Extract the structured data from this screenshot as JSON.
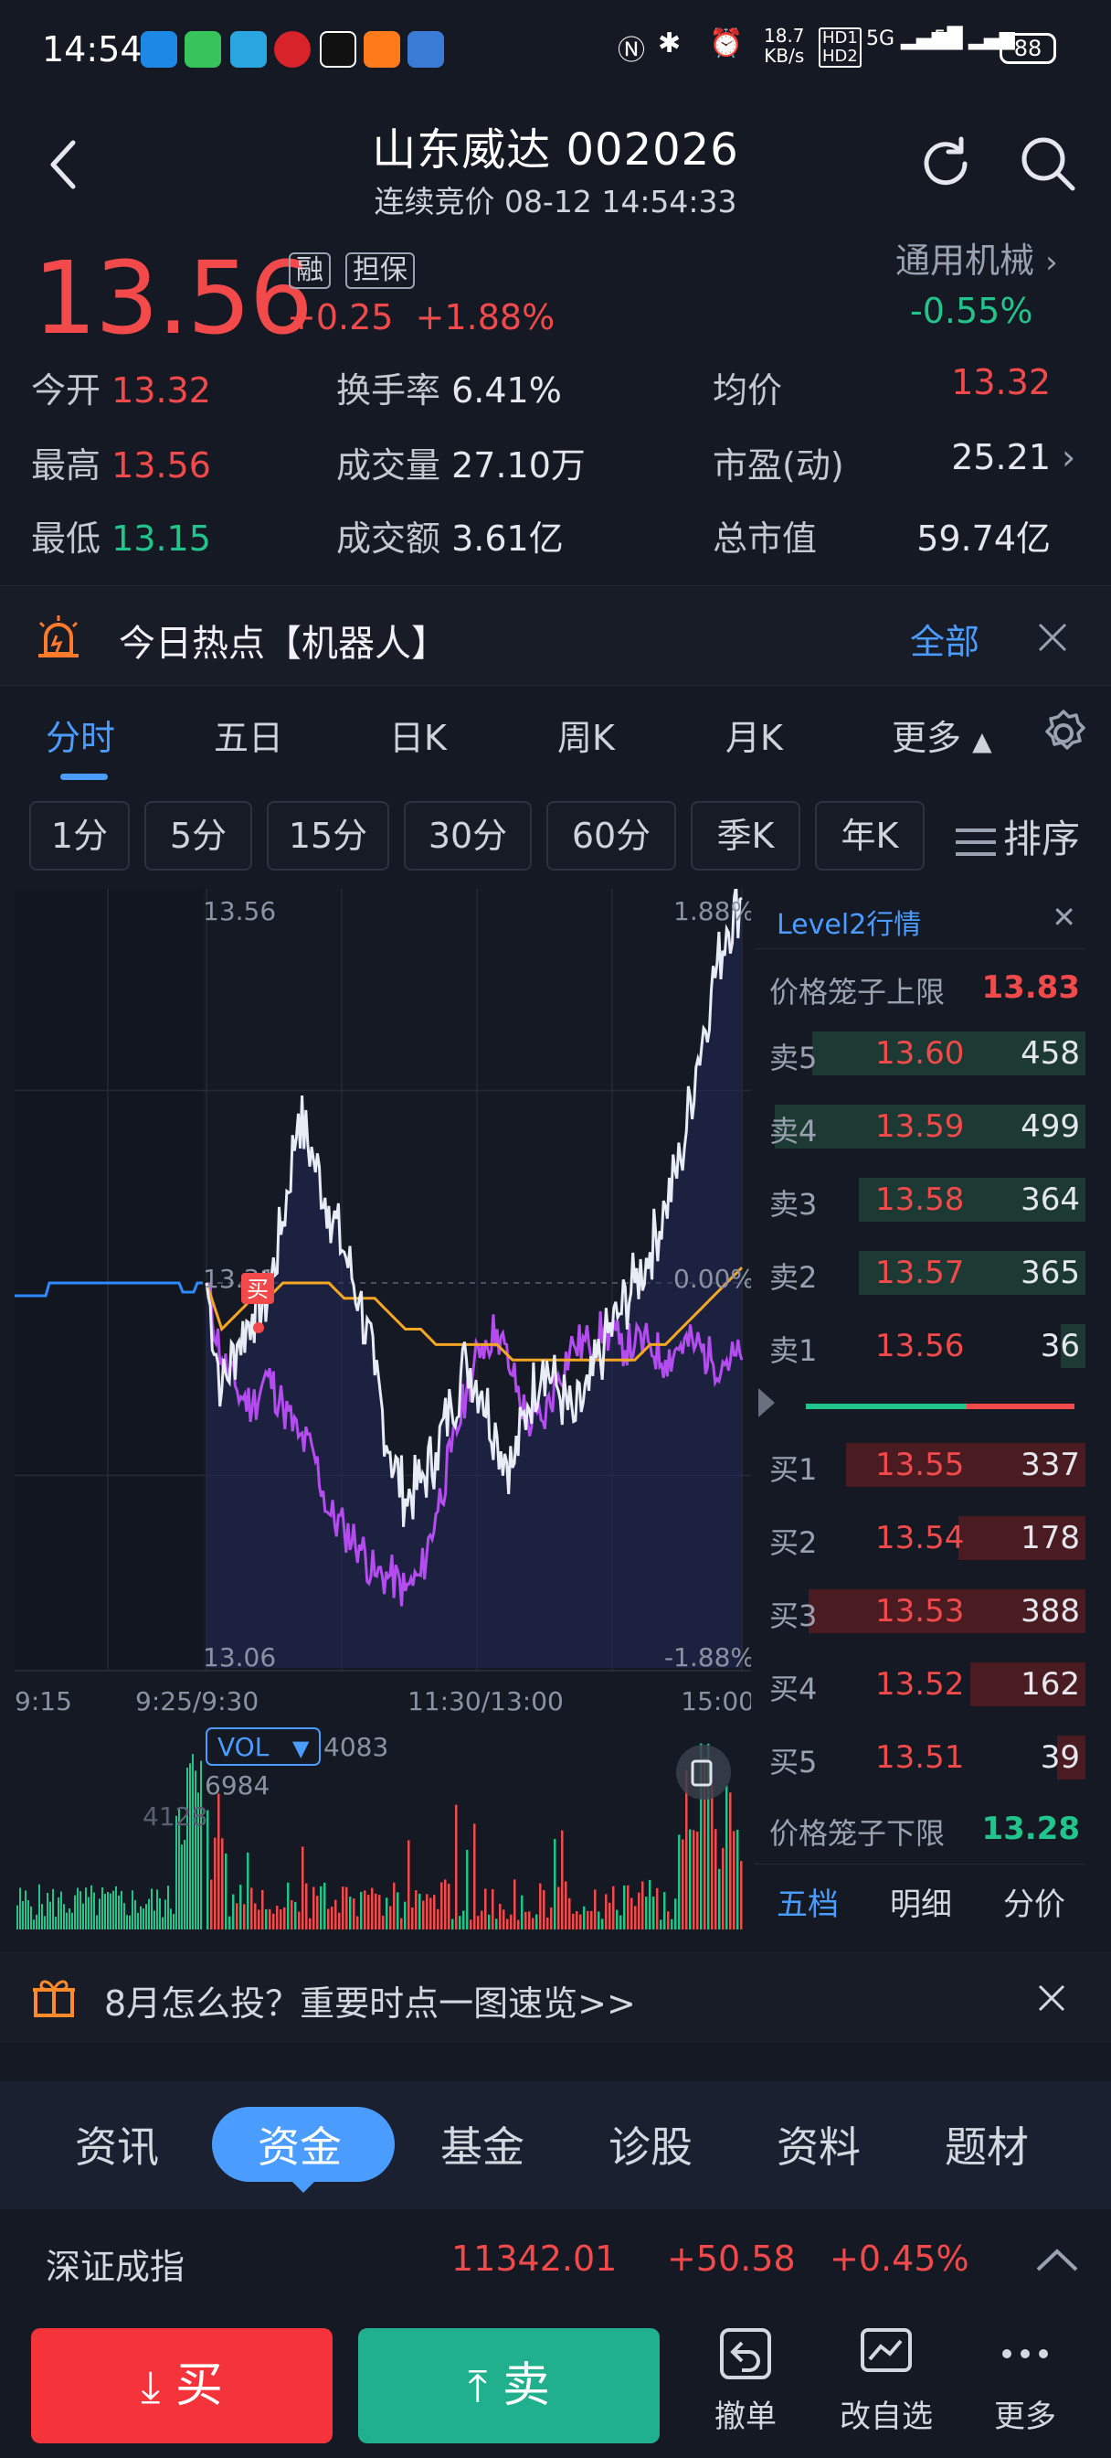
{
  "status_bar": {
    "time": "14:54",
    "network_speed_top": "18.7",
    "network_speed_unit": "KB/s",
    "hd1": "HD1",
    "hd2": "HD2",
    "sim1": "5G",
    "sim2": "5G",
    "battery": "88"
  },
  "header": {
    "title": "山东威达 002026",
    "subtitle": "连续竞价 08-12 14:54:33"
  },
  "quote": {
    "price": "13.56",
    "tag_margin": "融",
    "tag_guarantee": "担保",
    "change_abs": "+0.25",
    "change_pct": "+1.88%",
    "industry": "通用机械",
    "industry_change": "-0.55%"
  },
  "stats": [
    {
      "label": "今开",
      "value": "13.32"
    },
    {
      "label": "换手率",
      "value": "6.41%"
    },
    {
      "label": "均价",
      "value": "13.32"
    },
    {
      "label": "最高",
      "value": "13.56"
    },
    {
      "label": "成交量",
      "value": "27.10万"
    },
    {
      "label": "市盈(动)",
      "value": "25.21"
    },
    {
      "label": "最低",
      "value": "13.15"
    },
    {
      "label": "成交额",
      "value": "3.61亿"
    },
    {
      "label": "总市值",
      "value": "59.74亿"
    }
  ],
  "hot_topic": {
    "text": "今日热点【机器人】",
    "all_label": "全部"
  },
  "tabs": [
    "分时",
    "五日",
    "日K",
    "周K",
    "月K",
    "更多"
  ],
  "periods": [
    "1分",
    "5分",
    "15分",
    "30分",
    "60分",
    "季K",
    "年K"
  ],
  "sort_label": "排序",
  "chart": {
    "price_top": "13.56",
    "price_mid": "13.31",
    "price_bottom": "13.06",
    "pct_top": "1.88%",
    "pct_mid": "0.00%",
    "pct_bottom": "-1.88%",
    "time_labels": [
      "9:15",
      "9:25/9:30",
      "11:30/13:00",
      "15:00"
    ],
    "buy_marker": "买",
    "vol_label": "VOL",
    "vol_value": "4083",
    "vol_max": "6984",
    "vol_mid": "4128",
    "colors": {
      "price": "#e8ecf4",
      "avg": "#f5a623",
      "index": "#b44cf0",
      "vol_up": "#f24a4a",
      "vol_down": "#21c48a",
      "auction": "#2e8bff"
    }
  },
  "chart_data": {
    "type": "line",
    "ylim": [
      13.06,
      13.56
    ],
    "series": [
      {
        "values": [
          13.31,
          13.24,
          13.27,
          13.29,
          13.3,
          13.35,
          13.42,
          13.39,
          13.36,
          13.33,
          13.3,
          13.25,
          13.2,
          13.17,
          13.18,
          13.2,
          13.23,
          13.26,
          13.24,
          13.21,
          13.19,
          13.23,
          13.26,
          13.24,
          13.22,
          13.24,
          13.27,
          13.29,
          13.31,
          13.33,
          13.36,
          13.39,
          13.45,
          13.5,
          13.54,
          13.56
        ]
      },
      {
        "values": [
          13.31,
          13.28,
          13.29,
          13.3,
          13.3,
          13.31,
          13.31,
          13.31,
          13.31,
          13.3,
          13.3,
          13.3,
          13.29,
          13.28,
          13.28,
          13.27,
          13.27,
          13.27,
          13.27,
          13.27,
          13.26,
          13.26,
          13.26,
          13.26,
          13.26,
          13.26,
          13.26,
          13.26,
          13.26,
          13.27,
          13.27,
          13.28,
          13.29,
          13.3,
          13.31,
          13.32
        ]
      },
      {
        "values": [
          13.31,
          13.26,
          13.24,
          13.23,
          13.25,
          13.23,
          13.21,
          13.2,
          13.16,
          13.15,
          13.14,
          13.12,
          13.12,
          13.11,
          13.12,
          13.16,
          13.2,
          13.24,
          13.27,
          13.28,
          13.25,
          13.22,
          13.22,
          13.25,
          13.27,
          13.27,
          13.28,
          13.27,
          13.27,
          13.27,
          13.26,
          13.27,
          13.27,
          13.26,
          13.26,
          13.26
        ]
      }
    ]
  },
  "level2": {
    "title": "Level2行情",
    "upper_label": "价格笼子上限",
    "upper_value": "13.83",
    "asks": [
      {
        "label": "卖5",
        "price": "13.60",
        "vol": "458",
        "ratio": 0.88
      },
      {
        "label": "卖4",
        "price": "13.59",
        "vol": "499",
        "ratio": 1.0
      },
      {
        "label": "卖3",
        "price": "13.58",
        "vol": "364",
        "ratio": 0.73
      },
      {
        "label": "卖2",
        "price": "13.57",
        "vol": "365",
        "ratio": 0.73
      },
      {
        "label": "卖1",
        "price": "13.56",
        "vol": "36",
        "ratio": 0.08
      }
    ],
    "bids": [
      {
        "label": "买1",
        "price": "13.55",
        "vol": "337",
        "ratio": 0.77
      },
      {
        "label": "买2",
        "price": "13.54",
        "vol": "178",
        "ratio": 0.41
      },
      {
        "label": "买3",
        "price": "13.53",
        "vol": "388",
        "ratio": 0.89
      },
      {
        "label": "买4",
        "price": "13.52",
        "vol": "162",
        "ratio": 0.37
      },
      {
        "label": "买5",
        "price": "13.51",
        "vol": "39",
        "ratio": 0.09
      }
    ],
    "lower_label": "价格笼子下限",
    "lower_value": "13.28",
    "sub_tabs": [
      "五档",
      "明细",
      "分价"
    ],
    "balance_buy_ratio": 0.6
  },
  "banner": {
    "text": "8月怎么投？重要时点一图速览>>"
  },
  "bottom_tabs": [
    "资讯",
    "资金",
    "基金",
    "诊股",
    "资料",
    "题材"
  ],
  "index": {
    "name": "深证成指",
    "value": "11342.01",
    "change": "+50.58",
    "pct": "+0.45%"
  },
  "actions": {
    "buy": "买",
    "sell": "卖",
    "cancel": "撤单",
    "edit_watch": "改自选",
    "more": "更多"
  }
}
